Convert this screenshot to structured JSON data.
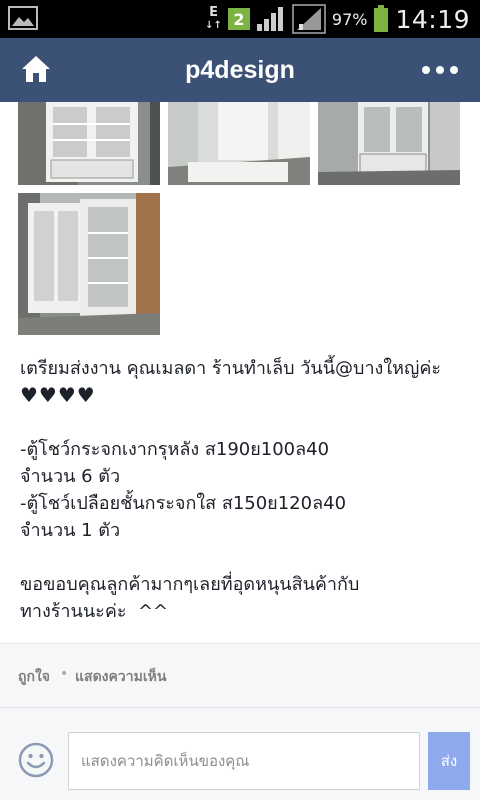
{
  "status_bar": {
    "network_type_top": "E",
    "network_type_bottom": "↓↑",
    "badge_count": "2",
    "battery_percent": "97%",
    "time": "14:19",
    "battery_color": "#7cb342"
  },
  "app_bar": {
    "title": "p4design",
    "background_color": "#3b5175",
    "home_icon": "home-icon",
    "more_icon": "more-dots-icon"
  },
  "photos": [
    {
      "name": "photo-1"
    },
    {
      "name": "photo-2"
    },
    {
      "name": "photo-3"
    },
    {
      "name": "photo-4"
    }
  ],
  "post": {
    "line1": "เตรียมส่งงาน คุณเมลดา ร้านทำเล็บ วันนี้@บางใหญ่ค่ะ",
    "hearts": "♥♥♥♥",
    "item1_line1": "-ตู้โชว์กระจกเงากรุหลัง ส190ย100ล40",
    "item1_line2": "จำนวน 6 ตัว",
    "item2_line1": "-ตู้โชว์เปลือยชั้นกระจกใส ส150ย120ล40",
    "item2_line2": "จำนวน 1 ตัว",
    "thanks_line1": "ขอขอบคุณลูกค้ามากๆเลยที่อุดหนุนสินค้ากับ",
    "thanks_line2": "ทางร้านนะค่ะ  ^^"
  },
  "actions": {
    "like_label": "ถูกใจ",
    "separator": "•",
    "comment_label": "แสดงความเห็น"
  },
  "composer": {
    "placeholder": "แสดงความคิดเห็นของคุณ",
    "send_label": "ส่ง",
    "send_color": "#8eaaed",
    "emoji_icon": "smiley-icon"
  }
}
